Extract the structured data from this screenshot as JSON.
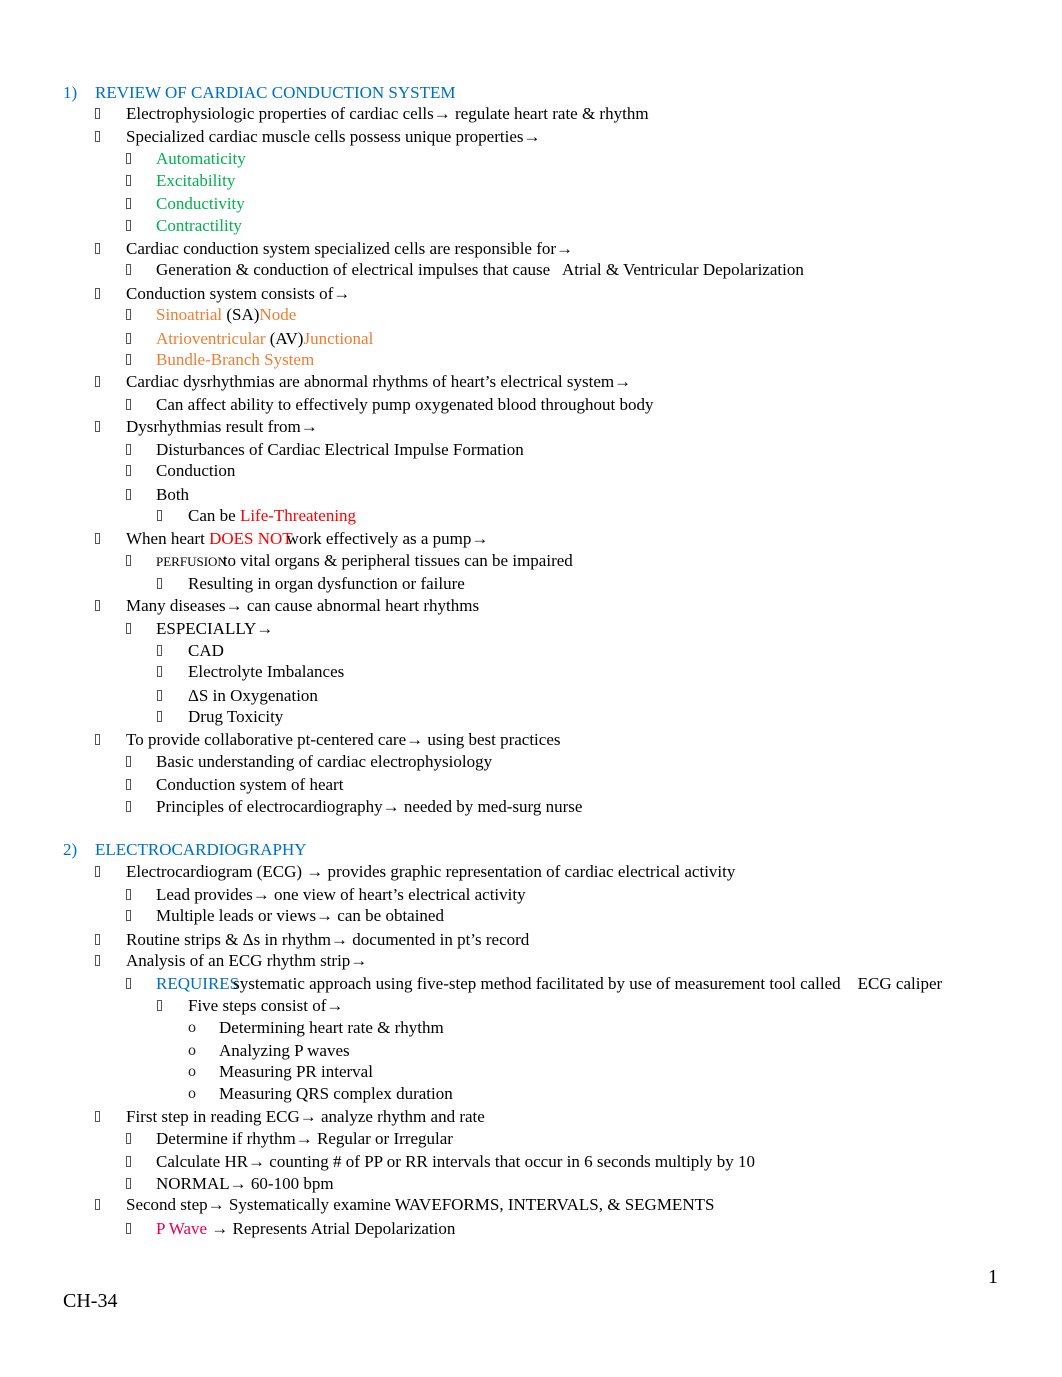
{
  "document": {
    "page_number": "1",
    "footer": "CH-34",
    "bullet_glyph": "missing-glyph-box",
    "colors": {
      "heading": "#0070C0",
      "green": "#00B050",
      "orange": "#ED7D31",
      "red": "#FF0000",
      "pink": "#E8005A"
    }
  },
  "sections": [
    {
      "number": "1)",
      "title": "REVIEW OF CARDIAC CONDUCTION SYSTEM",
      "lines": [
        {
          "level": 1,
          "text": "Electrophysiologic properties of cardiac cells→ regulate heart rate & rhythm"
        },
        {
          "level": 1,
          "text": "Specialized cardiac muscle cells possess unique properties→"
        },
        {
          "level": 2,
          "text": "Automaticity"
        },
        {
          "level": 2,
          "text": "Excitability"
        },
        {
          "level": 2,
          "text": "Conductivity"
        },
        {
          "level": 2,
          "text": "Contractility"
        },
        {
          "level": 1,
          "text": "Cardiac conduction system specialized cells are responsible for→"
        },
        {
          "level": 2,
          "text": "Generation & conduction of electrical impulses that cause   Atrial & Ventricular Depolarization"
        },
        {
          "level": 1,
          "text": "Conduction system consists of→"
        },
        {
          "level": 2,
          "parts": [
            "Sinoatrial",
            "(SA)",
            "Node"
          ]
        },
        {
          "level": 2,
          "parts": [
            "Atrioventricular",
            "(AV)",
            "Junctional"
          ]
        },
        {
          "level": 2,
          "text": "Bundle-Branch System"
        },
        {
          "level": 1,
          "text": "Cardiac dysrhythmias are abnormal rhythms of heart’s electrical system→"
        },
        {
          "level": 2,
          "text": "Can affect ability to effectively pump oxygenated blood throughout body"
        },
        {
          "level": 1,
          "text": "Dysrhythmias result from→"
        },
        {
          "level": 2,
          "text": "Disturbances of Cardiac Electrical Impulse Formation"
        },
        {
          "level": 2,
          "text": "Conduction"
        },
        {
          "level": 2,
          "text": "Both"
        },
        {
          "level": 3,
          "parts": [
            "Can be ",
            "Life-Threatening"
          ]
        },
        {
          "level": 1,
          "parts": [
            "When heart ",
            "DOES NOT",
            "work effectively as a pump→"
          ]
        },
        {
          "level": 2,
          "parts": [
            "PERFUSION",
            "to vital organs & peripheral tissues can be impaired"
          ]
        },
        {
          "level": 3,
          "text": "Resulting in organ dysfunction or failure"
        },
        {
          "level": 1,
          "text": "Many diseases→ can cause abnormal heart rhythms"
        },
        {
          "level": 2,
          "text": "ESPECIALLY→"
        },
        {
          "level": 3,
          "text": "CAD"
        },
        {
          "level": 3,
          "text": "Electrolyte Imbalances"
        },
        {
          "level": 3,
          "text": "ΔS in Oxygenation"
        },
        {
          "level": 3,
          "text": "Drug Toxicity"
        },
        {
          "level": 1,
          "text": "To provide collaborative pt-centered care→ using best practices"
        },
        {
          "level": 2,
          "text": "Basic understanding of cardiac electrophysiology"
        },
        {
          "level": 2,
          "text": "Conduction system of heart"
        },
        {
          "level": 2,
          "text": "Principles of electrocardiography→ needed by med-surg nurse"
        }
      ]
    },
    {
      "number": "2)",
      "title": "ELECTROCARDIOGRAPHY",
      "lines": [
        {
          "level": 1,
          "text": "Electrocardiogram (ECG) → provides graphic representation of cardiac electrical activity"
        },
        {
          "level": 2,
          "text": "Lead provides→ one view of heart’s electrical activity"
        },
        {
          "level": 2,
          "text": "Multiple leads or views→ can be obtained"
        },
        {
          "level": 1,
          "text": "Routine strips & Δs in rhythm→ documented in pt’s record"
        },
        {
          "level": 1,
          "text": "Analysis of an ECG rhythm strip→"
        },
        {
          "level": 2,
          "parts": [
            "REQUIRES",
            "systematic approach using five-step method facilitated by use of measurement tool called    ECG caliper"
          ]
        },
        {
          "level": 3,
          "text": "Five steps consist of→"
        },
        {
          "level": 4,
          "bullet": "o",
          "text": "Determining heart rate & rhythm"
        },
        {
          "level": 4,
          "bullet": "o",
          "text": "Analyzing P waves"
        },
        {
          "level": 4,
          "bullet": "o",
          "text": "Measuring PR interval"
        },
        {
          "level": 4,
          "bullet": "o",
          "text": "Measuring QRS complex duration"
        },
        {
          "level": 1,
          "text": "First step in reading ECG→ analyze rhythm and rate"
        },
        {
          "level": 2,
          "text": "Determine if rhythm→ Regular or Irregular"
        },
        {
          "level": 2,
          "text": "Calculate HR→ counting # of PP or RR intervals that occur in 6 seconds multiply by 10"
        },
        {
          "level": 2,
          "text": "NORMAL→ 60-100 bpm"
        },
        {
          "level": 1,
          "text": "Second step→ Systematically examine WAVEFORMS, INTERVALS, & SEGMENTS"
        },
        {
          "level": 2,
          "parts": [
            "P Wave",
            " → Represents Atrial Depolarization"
          ]
        }
      ]
    }
  ]
}
